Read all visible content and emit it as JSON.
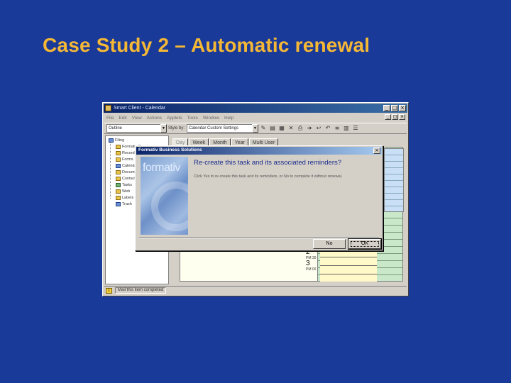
{
  "slide": {
    "title": "Case Study 2 – Automatic renewal"
  },
  "app": {
    "window_title": "Smart Client - Calendar",
    "menu": [
      "File",
      "Edit",
      "View",
      "Actions",
      "Applets",
      "Tools",
      "Window",
      "Help"
    ],
    "toolbar": {
      "view_combo": "Outline",
      "style_label": "Style by:",
      "style_combo": "Calendar Custom Settings"
    },
    "tree": {
      "root": "Filing",
      "items": [
        "Formativ Portals",
        "Records",
        "Forms",
        "Calendar",
        "Documents",
        "Contacts",
        "Tasks",
        "Web",
        "Labels",
        "Trash"
      ]
    },
    "tabs": [
      "Day",
      "Week",
      "Month",
      "Year",
      "Multi User"
    ],
    "day_numbers": [
      {
        "num": "2",
        "sub": "PM 30"
      },
      {
        "num": "3",
        "sub": "PM 00"
      }
    ],
    "status": {
      "text": "Mail this item completed"
    }
  },
  "dialog": {
    "title": "Formativ Business Solutions",
    "brand": "formativ",
    "question": "Re-create this task and its associated reminders?",
    "detail": "Click Yes to re-create this task and its reminders, or No to complete it without renewal.",
    "no_label": "No",
    "ok_label": "OK"
  }
}
